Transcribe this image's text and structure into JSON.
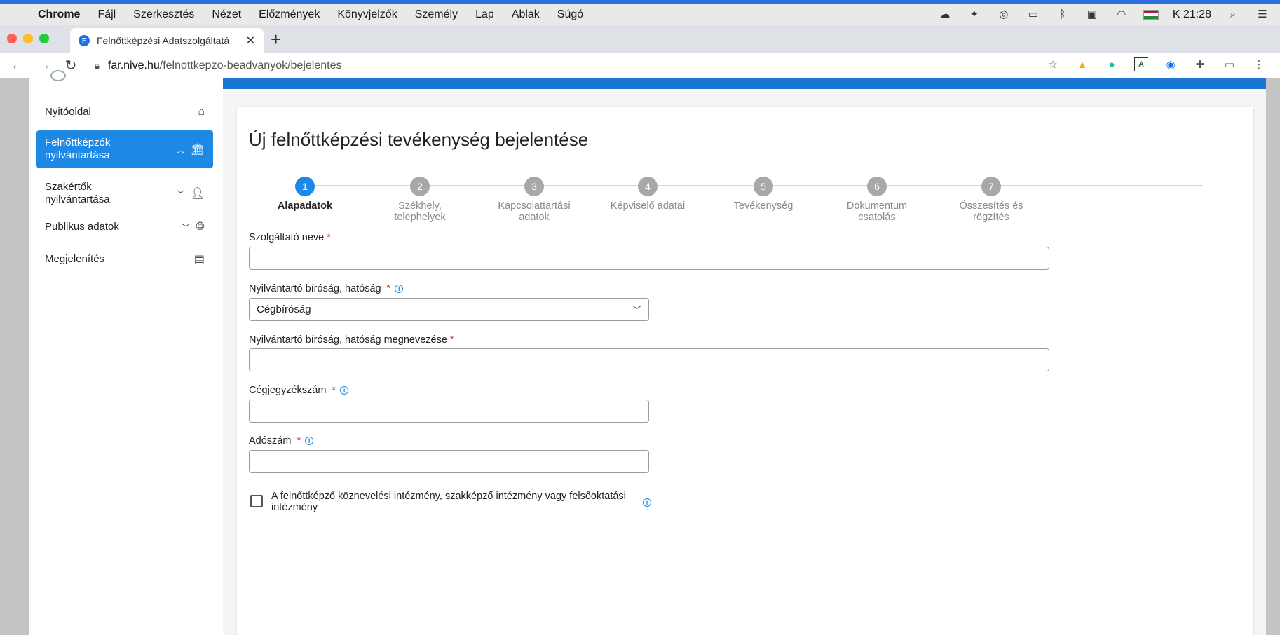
{
  "menubar": {
    "app": "Chrome",
    "items": [
      "Fájl",
      "Szerkesztés",
      "Nézet",
      "Előzmények",
      "Könyvjelzők",
      "Személy",
      "Lap",
      "Ablak",
      "Súgó"
    ],
    "clock": "K 21:28"
  },
  "browser": {
    "tab_title": "Felnőttképzési Adatszolgáltatá",
    "url_domain": "far.nive.hu",
    "url_path": "/felnottkepzo-beadvanyok/bejelentes"
  },
  "sidebar": {
    "items": [
      {
        "line1": "Nyitóoldal",
        "line2": "",
        "icon": "home-icon",
        "chevron": ""
      },
      {
        "line1": "Felnőttképzők",
        "line2": "nyilvántartása",
        "icon": "institution-icon",
        "chevron": "up"
      },
      {
        "line1": "Szakértők",
        "line2": "nyilvántartása",
        "icon": "person-icon",
        "chevron": "down"
      },
      {
        "line1": "Publikus adatok",
        "line2": "",
        "icon": "globe-icon",
        "chevron": "down"
      },
      {
        "line1": "Megjelenítés",
        "line2": "",
        "icon": "display-icon",
        "chevron": ""
      }
    ],
    "active_index": 1
  },
  "colors": {
    "accent": "#1e88e5",
    "header_band": "#1976d2",
    "required": "#e53935"
  },
  "main": {
    "title": "Új felnőttképzési tevékenység bejelentése",
    "steps": [
      {
        "num": "1",
        "line1": "Alapadatok",
        "line2": ""
      },
      {
        "num": "2",
        "line1": "Székhely, telephelyek",
        "line2": ""
      },
      {
        "num": "3",
        "line1": "Kapcsolattartási",
        "line2": "adatok"
      },
      {
        "num": "4",
        "line1": "Képviselő adatai",
        "line2": ""
      },
      {
        "num": "5",
        "line1": "Tevékenység",
        "line2": ""
      },
      {
        "num": "6",
        "line1": "Dokumentum",
        "line2": "csatolás"
      },
      {
        "num": "7",
        "line1": "Összesítés és",
        "line2": "rögzítés"
      }
    ],
    "active_step": 1,
    "form": {
      "provider_name_label": "Szolgáltató neve",
      "provider_name_value": "",
      "registry_label": "Nyilvántartó bíróság, hatóság",
      "registry_value": "Cégbíróság",
      "registry_name_label": "Nyilvántartó bíróság, hatóság megnevezése",
      "registry_name_value": "",
      "company_reg_label": "Cégjegyzékszám",
      "company_reg_value": "",
      "tax_label": "Adószám",
      "tax_value": "",
      "checkbox_label": "A felnőttképző köznevelési intézmény, szakképző intézmény vagy felsőoktatási intézmény",
      "checkbox_checked": false,
      "required_mark": "*",
      "info_glyph": "i"
    }
  }
}
